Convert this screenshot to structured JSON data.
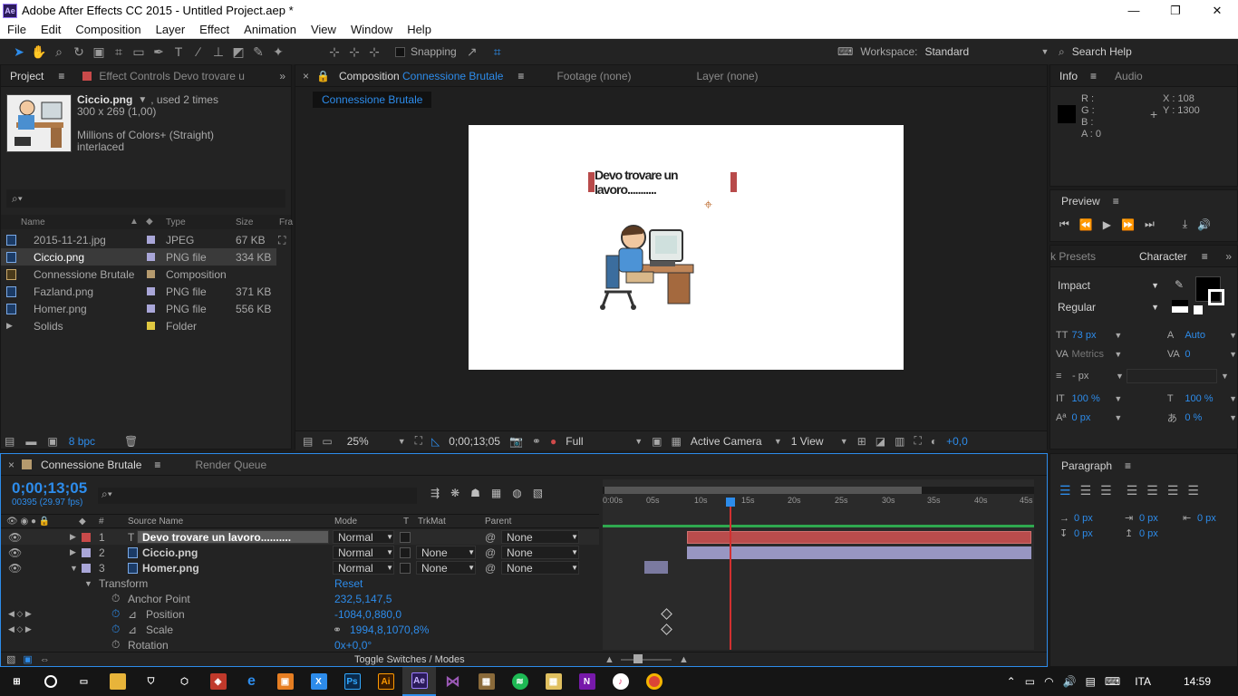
{
  "window": {
    "title": "Adobe After Effects CC 2015 - Untitled Project.aep *",
    "app_icon": "Ae",
    "min": "—",
    "max": "❐",
    "close": "✕"
  },
  "menu": [
    "File",
    "Edit",
    "Composition",
    "Layer",
    "Effect",
    "Animation",
    "View",
    "Window",
    "Help"
  ],
  "toolbar": {
    "snapping": "Snapping",
    "workspace_label": "Workspace:",
    "workspace_value": "Standard",
    "search_help": "Search Help"
  },
  "project": {
    "tab": "Project",
    "effect_controls_tab": "Effect Controls Devo trovare u",
    "selected_name": "Ciccio.png",
    "used": ", used 2 times",
    "dims": "300 x 269 (1,00)",
    "colors": "Millions of Colors+ (Straight)",
    "interlace": "interlaced",
    "search_placeholder": "",
    "headers": {
      "name": "Name",
      "type": "Type",
      "size": "Size",
      "fra": "Fra"
    },
    "items": [
      {
        "name": "2015-11-21.jpg",
        "type": "JPEG",
        "size": "67 KB",
        "color": "#a9a6d8"
      },
      {
        "name": "Ciccio.png",
        "type": "PNG file",
        "size": "334 KB",
        "color": "#a9a6d8"
      },
      {
        "name": "Connessione Brutale",
        "type": "Composition",
        "size": "",
        "color": "#b59a6e"
      },
      {
        "name": "Fazland.png",
        "type": "PNG file",
        "size": "371 KB",
        "color": "#a9a6d8"
      },
      {
        "name": "Homer.png",
        "type": "PNG file",
        "size": "556 KB",
        "color": "#a9a6d8"
      },
      {
        "name": "Solids",
        "type": "Folder",
        "size": "",
        "color": "#e0c841"
      }
    ],
    "bpc": "8 bpc"
  },
  "composition": {
    "tab_prefix": "Composition",
    "tab_name": "Connessione Brutale",
    "footage_tab": "Footage (none)",
    "layer_tab": "Layer (none)",
    "breadcrumb": "Connessione Brutale",
    "canvas_text": "Devo trovare un lavoro...........",
    "zoom": "25%",
    "timecode": "0;00;13;05",
    "resolution": "Full",
    "camera": "Active Camera",
    "views": "1 View",
    "exposure": "+0,0"
  },
  "info": {
    "tab": "Info",
    "audio_tab": "Audio",
    "r": "R :",
    "g": "G :",
    "b": "B :",
    "a": "A : 0",
    "x": "X : 108",
    "y": "Y : 1300"
  },
  "preview": {
    "title": "Preview"
  },
  "character": {
    "presets_tab": "k Presets",
    "tab": "Character",
    "font": "Impact",
    "style": "Regular",
    "size": "73 px",
    "leading": "Auto",
    "kerning": "Metrics",
    "tracking": "0",
    "stroke": "- px",
    "vscale": "100 %",
    "hscale": "100 %",
    "baseline": "0 px",
    "tsume": "0 %"
  },
  "paragraph": {
    "title": "Paragraph",
    "indent_left": "0 px",
    "indent_first": "0 px",
    "indent_right": "0 px",
    "space_before": "0 px",
    "space_after": "0 px"
  },
  "timeline": {
    "comp_tab": "Connessione Brutale",
    "render_tab": "Render Queue",
    "timecode": "0;00;13;05",
    "frames": "00395 (29.97 fps)",
    "headers": {
      "num": "#",
      "source": "Source Name",
      "mode": "Mode",
      "t": "T",
      "trkmat": "TrkMat",
      "parent": "Parent"
    },
    "ruler": [
      "0:00s",
      "05s",
      "10s",
      "15s",
      "20s",
      "25s",
      "30s",
      "35s",
      "40s",
      "45s"
    ],
    "layers": [
      {
        "num": "1",
        "name": "Devo trovare un lavoro..........",
        "mode": "Normal",
        "trkmat": "",
        "parent": "None",
        "color": "#c94a4a",
        "type": "T"
      },
      {
        "num": "2",
        "name": "Ciccio.png",
        "mode": "Normal",
        "trkmat": "None",
        "parent": "None",
        "color": "#a9a6d8",
        "type": "img"
      },
      {
        "num": "3",
        "name": "Homer.png",
        "mode": "Normal",
        "trkmat": "None",
        "parent": "None",
        "color": "#a9a6d8",
        "type": "img"
      }
    ],
    "transform": "Transform",
    "reset": "Reset",
    "props": [
      {
        "name": "Anchor Point",
        "value": "232,5,147,5"
      },
      {
        "name": "Position",
        "value": "-1084,0,880,0"
      },
      {
        "name": "Scale",
        "value": "1994,8,1070,8%"
      },
      {
        "name": "Rotation",
        "value": "0x+0,0°"
      }
    ],
    "toggle": "Toggle Switches / Modes"
  },
  "taskbar": {
    "lang": "ITA",
    "time": "14:59"
  }
}
